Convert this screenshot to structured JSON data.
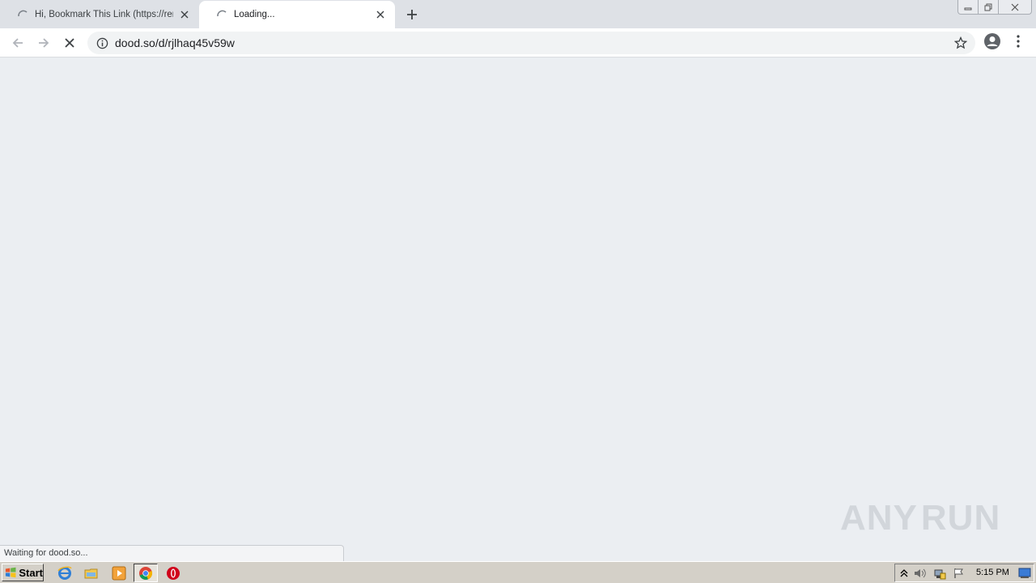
{
  "browser": {
    "tabs": [
      {
        "title": "Hi, Bookmark This Link (https://rentr",
        "state": "loading"
      },
      {
        "title": "Loading...",
        "state": "loading",
        "active": true
      }
    ],
    "address_bar": {
      "url": "dood.so/d/rjlhaq45v59w"
    },
    "status_text": "Waiting for dood.so..."
  },
  "watermark": {
    "left": "ANY",
    "right": "RUN"
  },
  "taskbar": {
    "start_label": "Start",
    "clock": "5:15 PM",
    "pinned": [
      "internet-explorer-icon",
      "explorer-folder-icon",
      "media-player-icon",
      "chrome-icon",
      "opera-icon"
    ]
  },
  "colors": {
    "tabstrip": "#dee1e6",
    "content_bg": "#ebeef2",
    "taskbar": "#d4d0c8"
  }
}
